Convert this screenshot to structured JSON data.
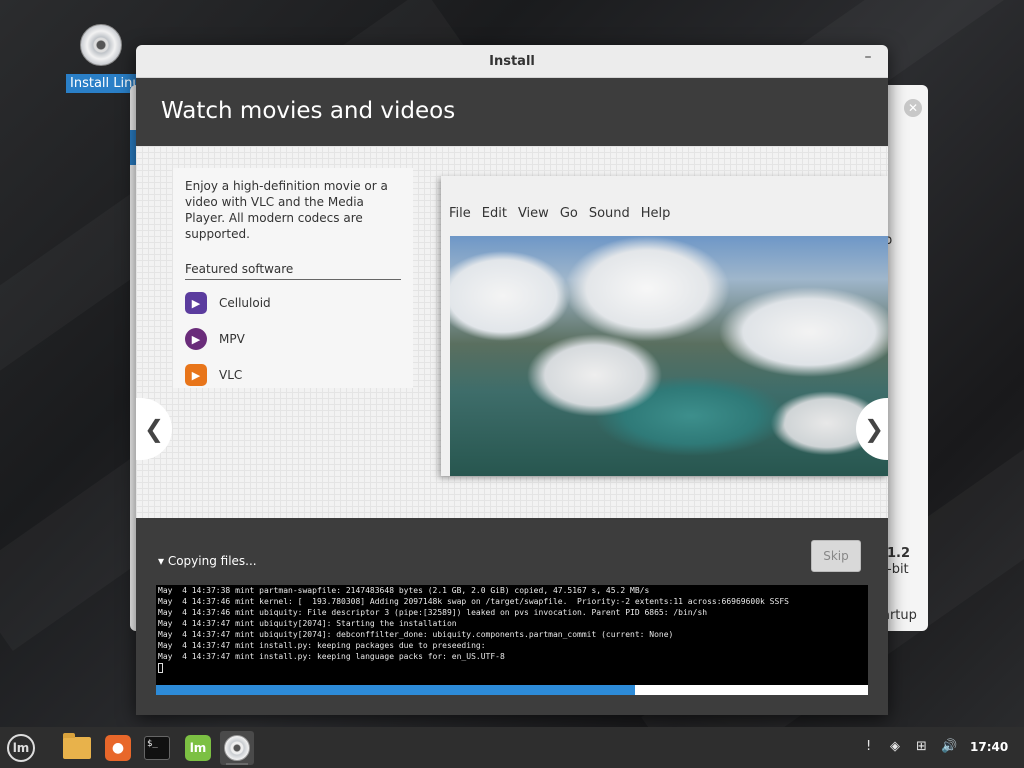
{
  "desktop": {
    "icon_label": "Install Linux Mint"
  },
  "background_window": {
    "partial_texts": {
      "text_1": "p",
      "text_2": "1.2",
      "text_3": "-bit",
      "text_4": "artup"
    }
  },
  "window": {
    "title": "Install",
    "minimize_label": "–"
  },
  "slide": {
    "title": "Watch movies and videos",
    "description": "Enjoy a high-definition movie or a video with VLC and the Media Player. All modern codecs are supported.",
    "featured_heading": "Featured software",
    "apps": [
      {
        "label": "Celluloid",
        "icon": "celluloid-icon",
        "color": "#5b3c9e"
      },
      {
        "label": "MPV",
        "icon": "mpv-icon",
        "color": "#6a2c7a"
      },
      {
        "label": "VLC",
        "icon": "vlc-icon",
        "color": "#e8751a"
      }
    ],
    "mock_menu": [
      "File",
      "Edit",
      "View",
      "Go",
      "Sound",
      "Help"
    ],
    "prev_glyph": "❮",
    "next_glyph": "❯"
  },
  "progress": {
    "status": "▾ Copying files...",
    "skip_label": "Skip",
    "percent": 67.3,
    "log_lines": [
      "May  4 14:37:38 mint partman-swapfile: 2147483648 bytes (2.1 GB, 2.0 GiB) copied, 47.5167 s, 45.2 MB/s",
      "May  4 14:37:46 mint kernel: [  193.780308] Adding 2097148k swap on /target/swapfile.  Priority:-2 extents:11 across:66969600k SSFS",
      "May  4 14:37:46 mint ubiquity: File descriptor 3 (pipe:[32589]) leaked on pvs invocation. Parent PID 6865: /bin/sh",
      "May  4 14:37:47 mint ubiquity[2074]: Starting the installation",
      "May  4 14:37:47 mint ubiquity[2074]: debconffilter_done: ubiquity.components.partman_commit (current: None)",
      "May  4 14:37:47 mint install.py: keeping packages due to preseeding:",
      "May  4 14:37:47 mint install.py: keeping language packs for: en_US.UTF-8"
    ]
  },
  "taskbar": {
    "items": [
      {
        "name": "menu-icon",
        "active": false
      },
      {
        "name": "files-icon",
        "active": false
      },
      {
        "name": "firefox-icon",
        "active": false
      },
      {
        "name": "terminal-icon",
        "active": false
      },
      {
        "name": "update-manager-icon",
        "active": false
      },
      {
        "name": "installer-icon",
        "active": true
      }
    ],
    "terminal_glyph": "$_",
    "mint_glyph": "lm",
    "firefox_glyph": "●",
    "tray_glyphs": {
      "notifications": "!",
      "shield": "◈",
      "network": "⊞",
      "volume": "🔊"
    },
    "clock": "17:40"
  }
}
